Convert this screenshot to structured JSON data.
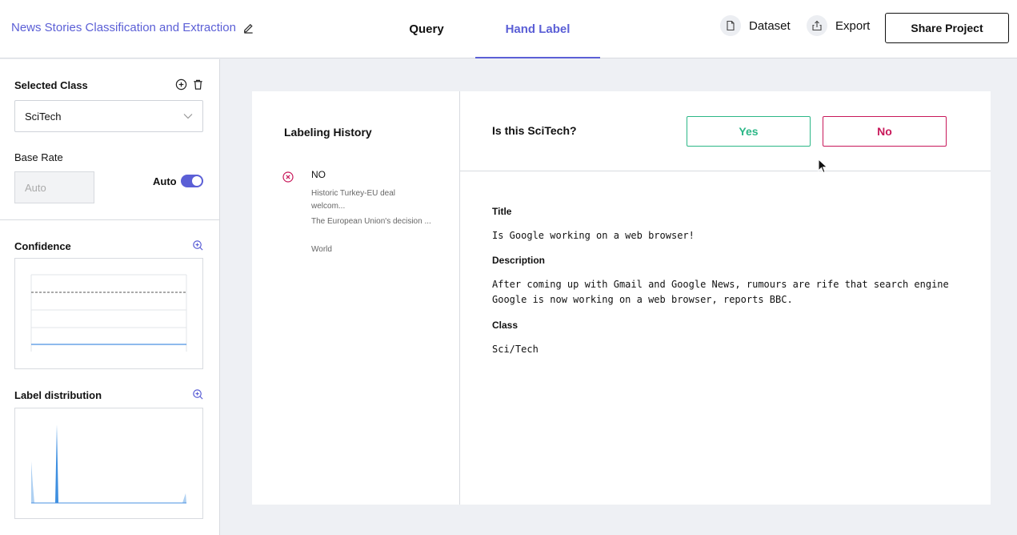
{
  "header": {
    "project_title": "News Stories Classification and Extraction",
    "tabs": [
      {
        "label": "Query"
      },
      {
        "label": "Hand Label"
      }
    ],
    "dataset_label": "Dataset",
    "export_label": "Export",
    "share_label": "Share Project",
    "accent": "#5b5fd6"
  },
  "sidebar": {
    "selected_class_label": "Selected Class",
    "selected_class_value": "SciTech",
    "base_rate_label": "Base Rate",
    "base_rate_placeholder": "Auto",
    "auto_label": "Auto",
    "auto_enabled": true,
    "confidence_label": "Confidence",
    "label_distribution_label": "Label distribution"
  },
  "history": {
    "title": "Labeling History",
    "entries": [
      {
        "label": "NO",
        "lines": [
          "Historic Turkey-EU deal welcom...",
          "The European Union's decision ...",
          "World"
        ]
      }
    ]
  },
  "question": {
    "text": "Is this SciTech?",
    "yes_label": "Yes",
    "no_label": "No",
    "yes_color": "#2cb787",
    "no_color": "#c8185a"
  },
  "record": {
    "title_head": "Title",
    "title_value": "Is Google working on a web browser!",
    "description_head": "Description",
    "description_value": "After coming up with Gmail and Google News, rumours are rife that search engine Google is now working on a web browser, reports BBC.",
    "class_head": "Class",
    "class_value": "Sci/Tech"
  }
}
